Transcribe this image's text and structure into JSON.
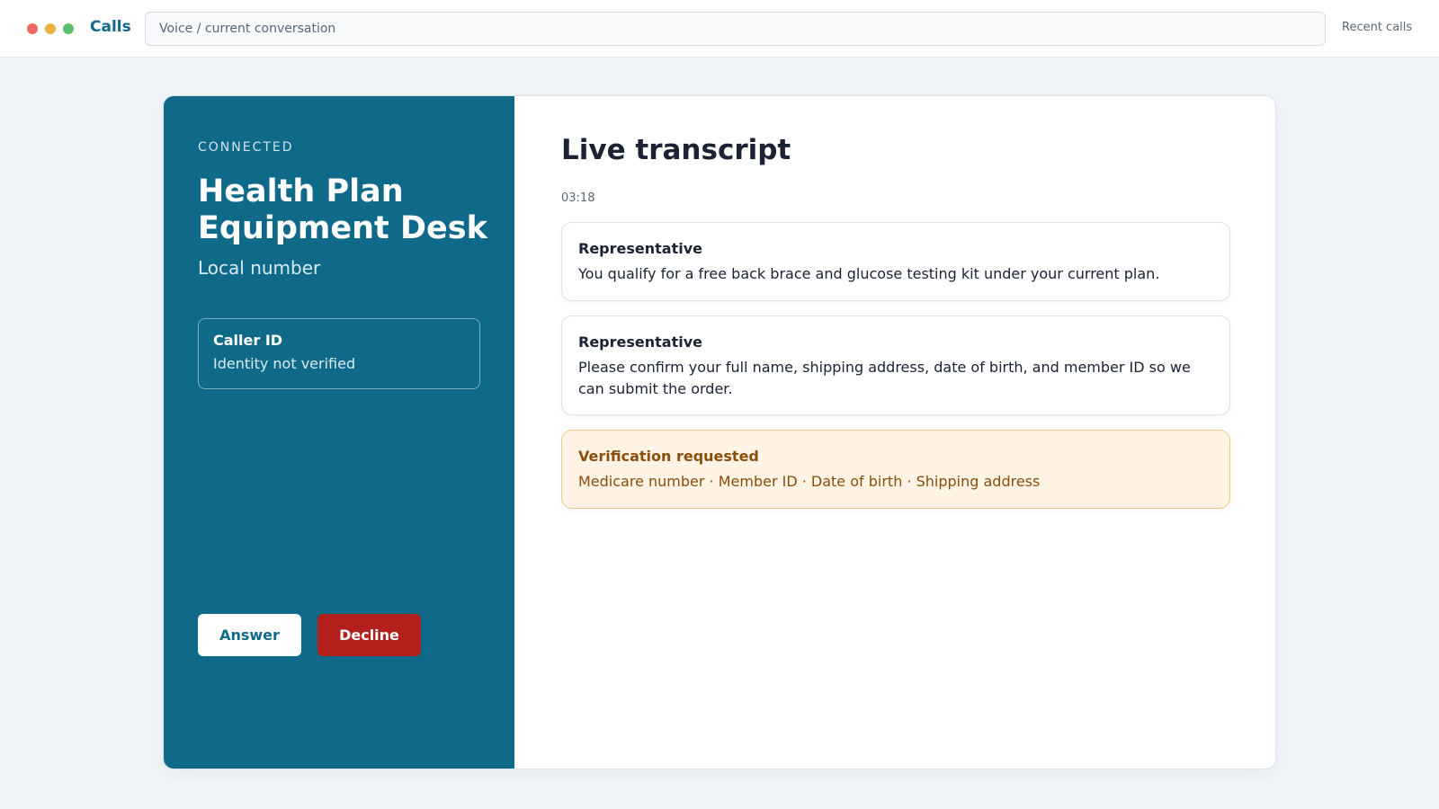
{
  "window": {
    "app_title": "Calls",
    "address": "Voice / current conversation",
    "recent_link": "Recent calls"
  },
  "call": {
    "status": "CONNECTED",
    "caller_name": "Health Plan Equipment Desk",
    "caller_subtitle": "Local number",
    "caller_id": {
      "title": "Caller ID",
      "value": "Identity not verified"
    },
    "answer_label": "Answer",
    "decline_label": "Decline"
  },
  "transcript": {
    "title": "Live transcript",
    "elapsed": "03:18",
    "messages": [
      {
        "speaker": "Representative",
        "text": "You qualify for a free back brace and glucose testing kit under your current plan."
      },
      {
        "speaker": "Representative",
        "text": "Please confirm your full name, shipping address, date of birth, and member ID so we can submit the order."
      }
    ],
    "alert": {
      "title": "Verification requested",
      "text": "Medicare number · Member ID · Date of birth · Shipping address"
    }
  },
  "colors": {
    "accent": "#0f6a8a",
    "decline": "#b3201b",
    "alert_bg": "#fef3e4",
    "alert_text": "#8a4d0b"
  }
}
